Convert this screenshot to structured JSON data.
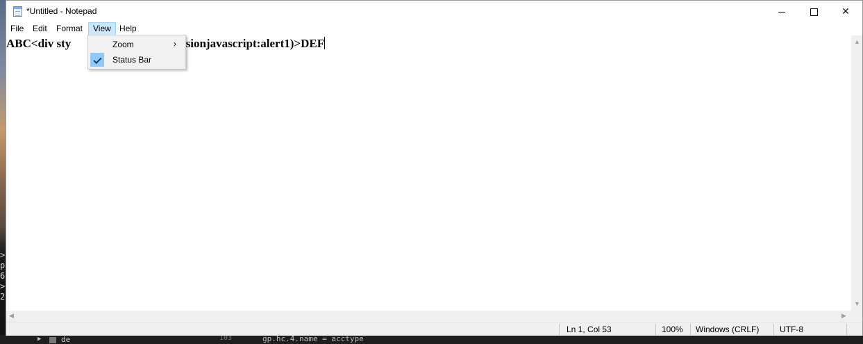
{
  "window": {
    "title": "*Untitled - Notepad"
  },
  "controls": {
    "minimize": "minimize",
    "maximize": "maximize",
    "close": "✕"
  },
  "menu": [
    {
      "label": "File"
    },
    {
      "label": "Edit"
    },
    {
      "label": "Format"
    },
    {
      "label": "View"
    },
    {
      "label": "Help"
    }
  ],
  "view_menu": {
    "items": [
      {
        "label": "Zoom",
        "submenu_icon": "chevron-right-icon"
      },
      {
        "label": "Status Bar",
        "checked": true
      }
    ]
  },
  "editor": {
    "visible_text_left": "ABC<div sty",
    "visible_text_right": "ssionjavascript:alert1)>DEF"
  },
  "status_bar": {
    "position": "Ln 1, Col 53",
    "zoom": "100%",
    "line_endings": "Windows (CRLF)",
    "encoding": "UTF-8"
  },
  "background": {
    "left_chars": ">\np\n6\n>\n2",
    "bottom_text": "de",
    "bottom_line_number": "103",
    "bottom_code": "gp.hc.4.name = acctype"
  },
  "colors": {
    "menu_active_bg": "#cce8ff",
    "check_highlight": "#90c8f6",
    "statusbar_bg": "#f0f0f0"
  }
}
